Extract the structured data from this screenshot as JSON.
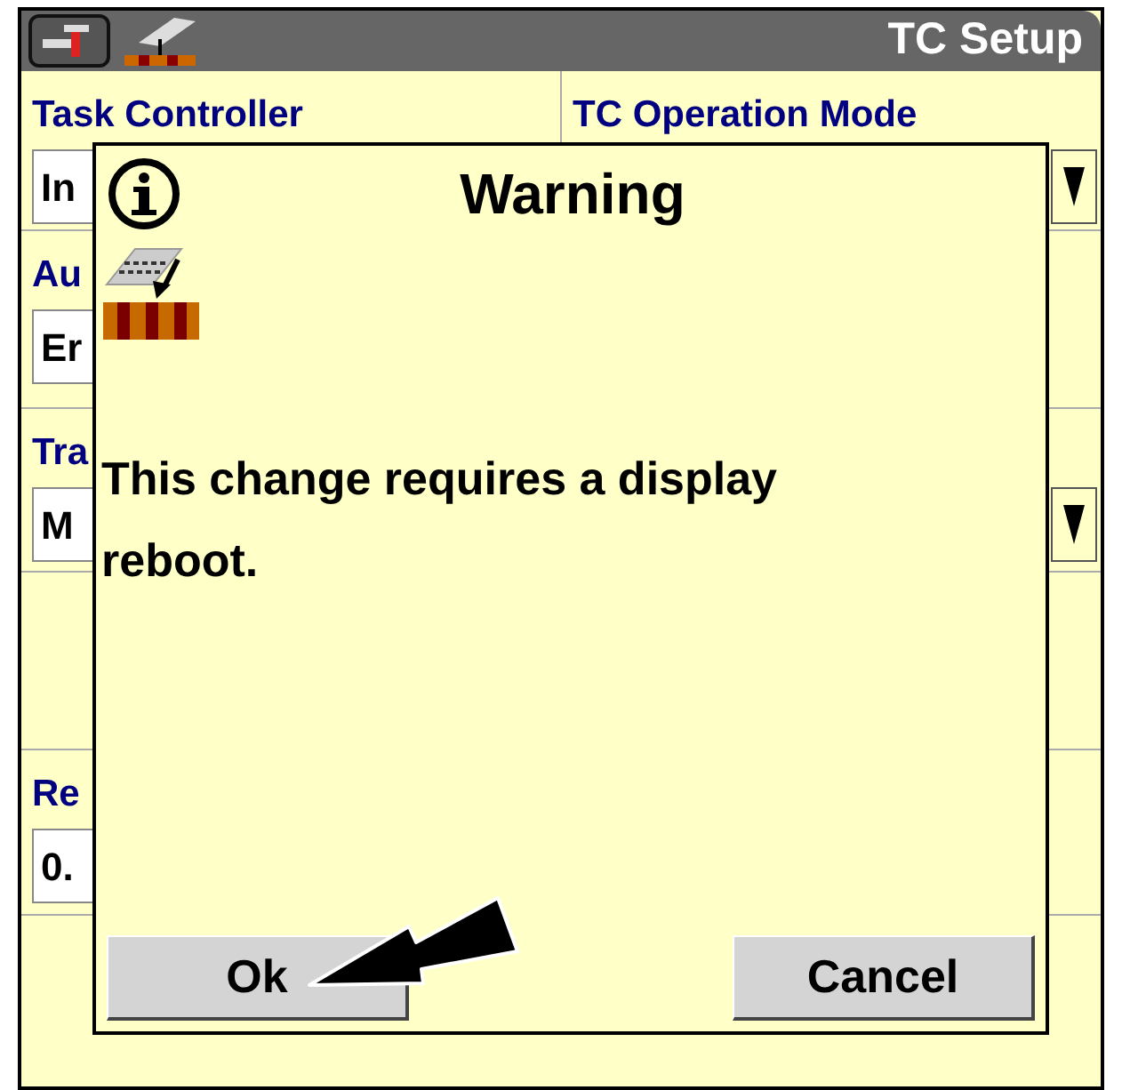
{
  "header": {
    "title": "TC Setup"
  },
  "rows": [
    {
      "kind": "fields",
      "cells": [
        {
          "label": "Task Controller",
          "value": "In",
          "dropdown": false
        },
        {
          "label": "TC Operation Mode",
          "dropdown": true
        }
      ]
    },
    {
      "kind": "fields",
      "cells": [
        {
          "label": "Au",
          "value": "Er",
          "dropdown": false
        }
      ]
    },
    {
      "kind": "fields",
      "cells": [
        {
          "label": "Tra",
          "value": "M",
          "dropdown": true
        }
      ]
    },
    {
      "kind": "blank"
    },
    {
      "kind": "fields",
      "cells": [
        {
          "label": "Re",
          "value": "0.",
          "dropdown": false
        }
      ]
    }
  ],
  "dialog": {
    "title": "Warning",
    "message": "This change requires a display reboot.",
    "buttons": [
      "Ok",
      "Cancel"
    ]
  }
}
